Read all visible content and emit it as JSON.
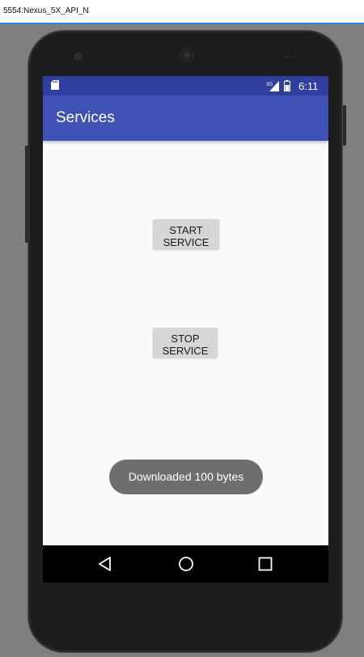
{
  "window": {
    "title": "5554:Nexus_5X_API_N"
  },
  "status_bar": {
    "network": "3G",
    "time": "6:11"
  },
  "app_bar": {
    "title": "Services"
  },
  "buttons": {
    "start_label": "START SERVICE",
    "stop_label": "STOP SERVICE"
  },
  "toast": {
    "message": "Downloaded 100 bytes"
  },
  "colors": {
    "status_bar": "#303f9f",
    "app_bar": "#3f51b5",
    "toast": "#6e6e6e"
  },
  "nav_bar": {
    "icons": [
      "back-icon",
      "home-icon",
      "recents-icon"
    ]
  }
}
